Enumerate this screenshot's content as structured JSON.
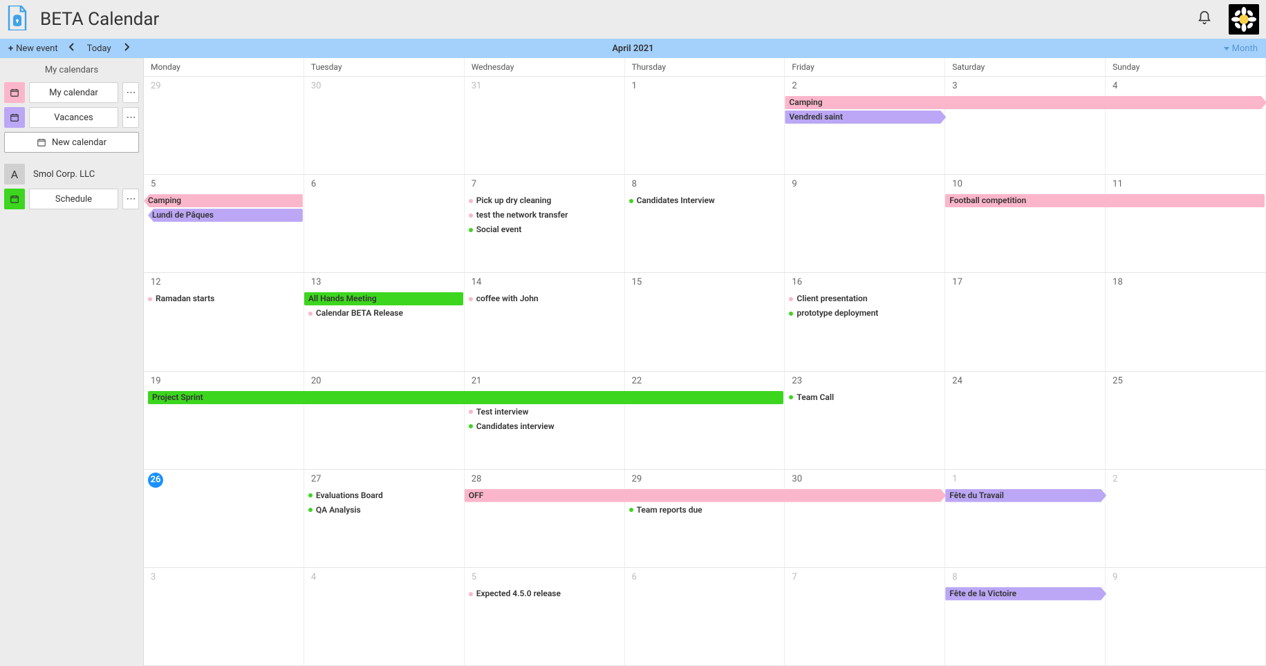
{
  "header": {
    "title": "BETA Calendar"
  },
  "toolbar": {
    "new_event_label": "New event",
    "today_label": "Today",
    "period_label": "April 2021",
    "view_label": "Month"
  },
  "sidebar": {
    "section_title": "My calendars",
    "calendars": [
      {
        "name": "My calendar",
        "color": "#fcb6cb"
      },
      {
        "name": "Vacances",
        "color": "#bba7f5"
      }
    ],
    "new_calendar_label": "New calendar",
    "org": {
      "initial": "A",
      "name": "Smol Corp. LLC"
    },
    "shared_calendars": [
      {
        "name": "Schedule",
        "color": "#3cd61e"
      }
    ]
  },
  "days": [
    "Monday",
    "Tuesday",
    "Wednesday",
    "Thursday",
    "Friday",
    "Saturday",
    "Sunday"
  ],
  "grid": [
    [
      {
        "n": "29",
        "other": true
      },
      {
        "n": "30",
        "other": true
      },
      {
        "n": "31",
        "other": true
      },
      {
        "n": "1"
      },
      {
        "n": "2"
      },
      {
        "n": "3"
      },
      {
        "n": "4"
      }
    ],
    [
      {
        "n": "5"
      },
      {
        "n": "6"
      },
      {
        "n": "7"
      },
      {
        "n": "8"
      },
      {
        "n": "9"
      },
      {
        "n": "10"
      },
      {
        "n": "11"
      }
    ],
    [
      {
        "n": "12"
      },
      {
        "n": "13"
      },
      {
        "n": "14"
      },
      {
        "n": "15"
      },
      {
        "n": "16"
      },
      {
        "n": "17"
      },
      {
        "n": "18"
      }
    ],
    [
      {
        "n": "19"
      },
      {
        "n": "20"
      },
      {
        "n": "21"
      },
      {
        "n": "22"
      },
      {
        "n": "23"
      },
      {
        "n": "24"
      },
      {
        "n": "25"
      }
    ],
    [
      {
        "n": "26",
        "today": true
      },
      {
        "n": "27"
      },
      {
        "n": "28"
      },
      {
        "n": "29"
      },
      {
        "n": "30"
      },
      {
        "n": "1",
        "other": true
      },
      {
        "n": "2",
        "other": true
      }
    ],
    [
      {
        "n": "3",
        "other": true
      },
      {
        "n": "4",
        "other": true
      },
      {
        "n": "5",
        "other": true
      },
      {
        "n": "6",
        "other": true
      },
      {
        "n": "7",
        "other": true
      },
      {
        "n": "8",
        "other": true
      },
      {
        "n": "9",
        "other": true
      }
    ]
  ],
  "events": [
    {
      "week": 0,
      "row": 0,
      "start": 4,
      "span": 3,
      "type": "bar",
      "color": "pink",
      "cut": "right",
      "label": "Camping"
    },
    {
      "week": 0,
      "row": 1,
      "start": 4,
      "span": 1,
      "type": "bar",
      "color": "purple",
      "cut": "right",
      "label": "Vendredi saint"
    },
    {
      "week": 1,
      "row": 0,
      "start": 0,
      "span": 1,
      "type": "bar",
      "color": "pink",
      "cut": "left",
      "label": "Camping"
    },
    {
      "week": 1,
      "row": 1,
      "start": 0,
      "span": 1,
      "type": "bar",
      "color": "purple",
      "cut": "left",
      "label": "Lundi de Pâques",
      "startInset": 6
    },
    {
      "week": 1,
      "row": 0,
      "start": 2,
      "span": 1,
      "type": "dot",
      "color": "pink",
      "label": "Pick up dry cleaning"
    },
    {
      "week": 1,
      "row": 1,
      "start": 2,
      "span": 1,
      "type": "dot",
      "color": "pink",
      "label": "test the network transfer"
    },
    {
      "week": 1,
      "row": 2,
      "start": 2,
      "span": 1,
      "type": "dot",
      "color": "green",
      "label": "Social event"
    },
    {
      "week": 1,
      "row": 0,
      "start": 3,
      "span": 1,
      "type": "dot",
      "color": "green",
      "label": "Candidates Interview"
    },
    {
      "week": 1,
      "row": 0,
      "start": 5,
      "span": 2,
      "type": "bar",
      "color": "pink",
      "label": "Football competition"
    },
    {
      "week": 2,
      "row": 0,
      "start": 0,
      "span": 1,
      "type": "dot",
      "color": "pink",
      "label": "Ramadan starts"
    },
    {
      "week": 2,
      "row": 0,
      "start": 1,
      "span": 1,
      "type": "bar",
      "color": "green",
      "label": "All Hands Meeting"
    },
    {
      "week": 2,
      "row": 1,
      "start": 1,
      "span": 1,
      "type": "dot",
      "color": "pink",
      "label": "Calendar BETA Release"
    },
    {
      "week": 2,
      "row": 0,
      "start": 2,
      "span": 1,
      "type": "dot",
      "color": "pink",
      "label": "coffee with John"
    },
    {
      "week": 2,
      "row": 0,
      "start": 4,
      "span": 1,
      "type": "dot",
      "color": "pink",
      "label": "Client presentation"
    },
    {
      "week": 2,
      "row": 1,
      "start": 4,
      "span": 1,
      "type": "dot",
      "color": "green",
      "label": "prototype deployment"
    },
    {
      "week": 3,
      "row": 0,
      "start": 0,
      "span": 4,
      "type": "bar",
      "color": "green",
      "label": "Project Sprint",
      "startInset": 6
    },
    {
      "week": 3,
      "row": 1,
      "start": 2,
      "span": 1,
      "type": "dot",
      "color": "pink",
      "label": "Test interview"
    },
    {
      "week": 3,
      "row": 2,
      "start": 2,
      "span": 1,
      "type": "dot",
      "color": "green",
      "label": "Candidates interview"
    },
    {
      "week": 3,
      "row": 0,
      "start": 4,
      "span": 1,
      "type": "dot",
      "color": "green",
      "label": "Team Call"
    },
    {
      "week": 4,
      "row": 0,
      "start": 1,
      "span": 1,
      "type": "dot",
      "color": "green",
      "label": "Evaluations Board"
    },
    {
      "week": 4,
      "row": 1,
      "start": 1,
      "span": 1,
      "type": "dot",
      "color": "green",
      "label": "QA Analysis"
    },
    {
      "week": 4,
      "row": 0,
      "start": 2,
      "span": 3,
      "type": "bar",
      "color": "pink",
      "cut": "right",
      "label": "OFF"
    },
    {
      "week": 4,
      "row": 1,
      "start": 3,
      "span": 1,
      "type": "dot",
      "color": "green",
      "label": "Team reports due"
    },
    {
      "week": 4,
      "row": 0,
      "start": 5,
      "span": 1,
      "type": "bar",
      "color": "purple",
      "cut": "right",
      "label": "Fête du Travail"
    },
    {
      "week": 5,
      "row": 0,
      "start": 2,
      "span": 1,
      "type": "dot",
      "color": "pink",
      "label": "Expected 4.5.0 release"
    },
    {
      "week": 5,
      "row": 0,
      "start": 5,
      "span": 1,
      "type": "bar",
      "color": "purple",
      "cut": "right",
      "label": "Fête de la Victoire"
    }
  ]
}
